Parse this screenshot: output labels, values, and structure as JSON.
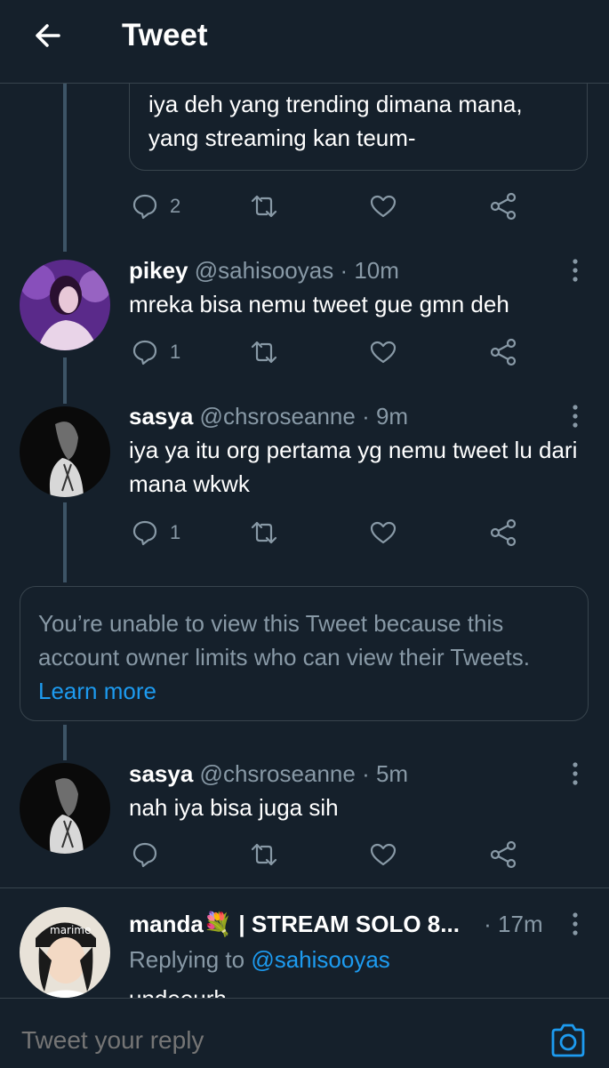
{
  "header": {
    "title": "Tweet"
  },
  "quoted": {
    "text": "iya deh yang trending dimana mana, yang streaming kan teum-",
    "reply_count": "2"
  },
  "tweets": [
    {
      "name": "pikey",
      "handle": "@sahisooyas",
      "time": "· 10m",
      "text": "mreka bisa nemu tweet gue gmn deh",
      "reply_count": "1"
    },
    {
      "name": "sasya",
      "handle": "@chsroseanne",
      "time": "· 9m",
      "text": "iya ya itu org pertama yg nemu tweet lu dari mana wkwk",
      "reply_count": "1"
    },
    {
      "name": "sasya",
      "handle": "@chsroseanne",
      "time": "· 5m",
      "text": "nah iya bisa juga sih",
      "reply_count": ""
    }
  ],
  "notice": {
    "text": "You’re unable to view this Tweet because this account owner limits who can view their Tweets.",
    "link": "Learn more"
  },
  "last_tweet": {
    "name": "manda💐 | STREAM SOLO 8...",
    "time": "· 17m",
    "replying_label": "Replying to",
    "replying_handle": "@sahisooyas",
    "partial_text": "undeeurh"
  },
  "reply_bar": {
    "placeholder": "Tweet your reply"
  },
  "icons": [
    "back-arrow-icon",
    "reply-icon",
    "retweet-icon",
    "like-icon",
    "share-icon",
    "more-icon",
    "camera-icon"
  ],
  "colors": {
    "background": "#15202b",
    "accent": "#1d9bf0",
    "muted": "#8899a6",
    "border": "#38444d"
  }
}
